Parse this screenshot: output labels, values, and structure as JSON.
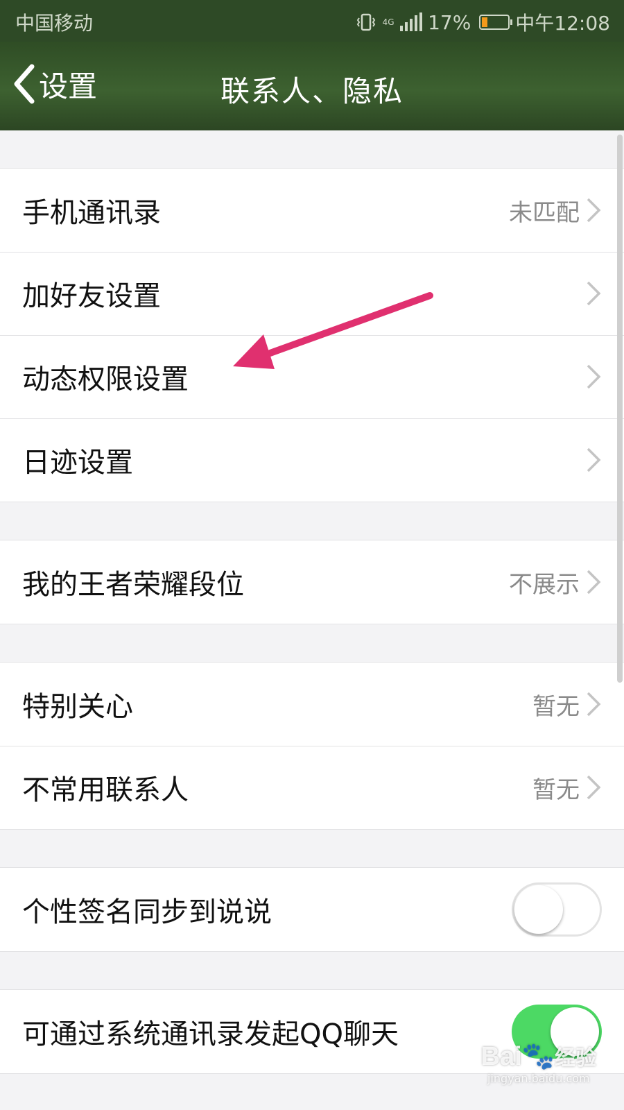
{
  "status_bar": {
    "carrier": "中国移动",
    "network": "4G",
    "battery_percent": "17%",
    "time": "中午12:08",
    "battery_color": "#f39a1b"
  },
  "nav": {
    "back_label": "设置",
    "title": "联系人、隐私"
  },
  "groups": [
    {
      "rows": [
        {
          "label": "手机通讯录",
          "value": "未匹配"
        },
        {
          "label": "加好友设置",
          "value": ""
        },
        {
          "label": "动态权限设置",
          "value": ""
        },
        {
          "label": "日迹设置",
          "value": ""
        }
      ]
    },
    {
      "rows": [
        {
          "label": "我的王者荣耀段位",
          "value": "不展示"
        }
      ]
    },
    {
      "rows": [
        {
          "label": "特别关心",
          "value": "暂无"
        },
        {
          "label": "不常用联系人",
          "value": "暂无"
        }
      ]
    },
    {
      "rows": [
        {
          "label": "个性签名同步到说说",
          "toggle": false
        }
      ]
    },
    {
      "rows": [
        {
          "label": "可通过系统通讯录发起QQ聊天",
          "toggle": true
        }
      ]
    }
  ],
  "watermark": {
    "logo_text": "Bai",
    "logo_suffix": "经验",
    "url": "jingyan.baidu.com"
  },
  "colors": {
    "toggle_on": "#4cd964",
    "annotation_arrow": "#e0306f",
    "nav_green": "#2f4d25"
  }
}
